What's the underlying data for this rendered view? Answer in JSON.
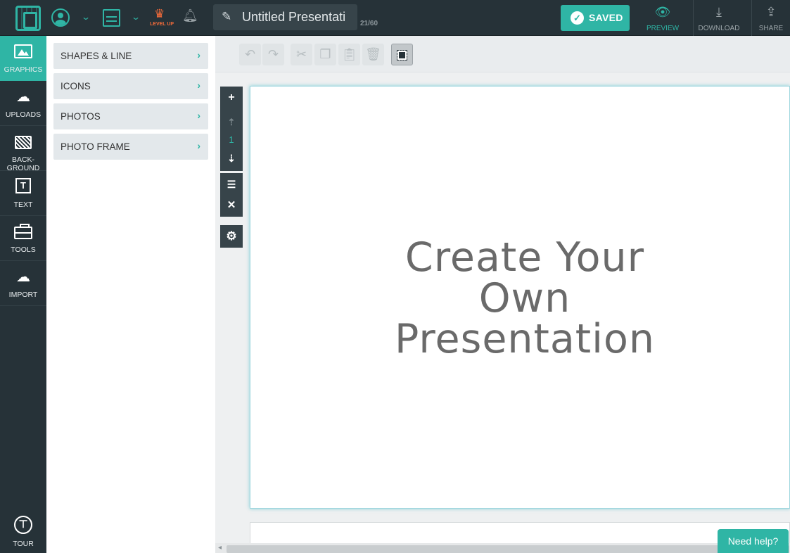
{
  "app": {
    "document_title": "Untitled Presentati⁠",
    "char_count": "21/60",
    "level_up": "LEVEL UP",
    "saved_label": "SAVED",
    "actions": {
      "preview": "PREVIEW",
      "download": "DOWNLOAD",
      "share": "SHARE"
    },
    "accent_color": "#2fb5a5",
    "dark_color": "#263238"
  },
  "icons": {
    "logo": "logo-icon",
    "account": "user-circle-icon",
    "designs": "cabinet-icon",
    "crown": "crown-icon",
    "bell": "bell-icon",
    "pencil": "pencil-icon",
    "check": "check-icon",
    "preview": "eye-icon",
    "download": "download-icon",
    "share": "share-icon"
  },
  "sidebar": {
    "items": [
      {
        "label": "GRAPHICS",
        "icon": "image-icon",
        "active": true
      },
      {
        "label": "UPLOADS",
        "icon": "cloud-upload-icon"
      },
      {
        "label": "BACK-\nGROUND",
        "line1": "BACK-",
        "line2": "GROUND",
        "icon": "monitor-icon"
      },
      {
        "label": "TEXT",
        "icon": "text-box-icon"
      },
      {
        "label": "TOOLS",
        "icon": "toolbox-icon"
      },
      {
        "label": "IMPORT",
        "icon": "cloud-download-icon"
      }
    ],
    "tour": "TOUR"
  },
  "panel": {
    "items": [
      {
        "label": "SHAPES & LINE"
      },
      {
        "label": "ICONS"
      },
      {
        "label": "PHOTOS"
      },
      {
        "label": "PHOTO FRAME"
      }
    ]
  },
  "toolbar": {
    "buttons": [
      "undo-icon",
      "redo-icon",
      "cut-icon",
      "copy-icon",
      "paste-icon",
      "delete-icon",
      "layer-icon"
    ]
  },
  "slide_tools": {
    "page_number": "1"
  },
  "slide": {
    "line1": "Create Your",
    "line2": "Own",
    "line3": "Presentation"
  },
  "help": {
    "label": "Need help?"
  }
}
